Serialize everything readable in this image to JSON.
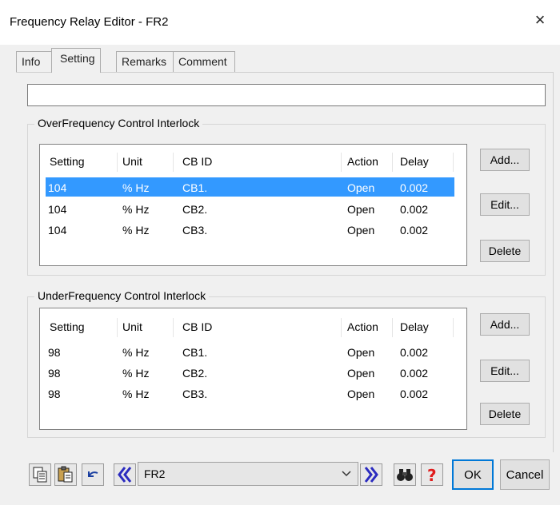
{
  "window": {
    "title": "Frequency Relay Editor - FR2",
    "close_glyph": "×"
  },
  "tabs": [
    {
      "label": "Info",
      "active": false
    },
    {
      "label": "Setting",
      "active": true
    },
    {
      "label": "Remarks",
      "active": false
    },
    {
      "label": "Comment",
      "active": false
    }
  ],
  "top_field": {
    "value": ""
  },
  "over": {
    "title": "OverFrequency Control Interlock",
    "columns": [
      "Setting",
      "Unit",
      "CB ID",
      "Action",
      "Delay"
    ],
    "rows": [
      [
        "104",
        "% Hz",
        "CB1.",
        "Open",
        "0.002"
      ],
      [
        "104",
        "% Hz",
        "CB2.",
        "Open",
        "0.002"
      ],
      [
        "104",
        "% Hz",
        "CB3.",
        "Open",
        "0.002"
      ]
    ],
    "selected_row": 0,
    "buttons": {
      "add": "Add...",
      "edit": "Edit...",
      "delete": "Delete"
    }
  },
  "under": {
    "title": "UnderFrequency Control Interlock",
    "columns": [
      "Setting",
      "Unit",
      "CB ID",
      "Action",
      "Delay"
    ],
    "rows": [
      [
        "98",
        "% Hz",
        "CB1.",
        "Open",
        "0.002"
      ],
      [
        "98",
        "% Hz",
        "CB2.",
        "Open",
        "0.002"
      ],
      [
        "98",
        "% Hz",
        "CB3.",
        "Open",
        "0.002"
      ]
    ],
    "buttons": {
      "add": "Add...",
      "edit": "Edit...",
      "delete": "Delete"
    }
  },
  "footer": {
    "nav_value": "FR2",
    "ok": "OK",
    "cancel": "Cancel"
  },
  "icons": {
    "copy": "copy-icon",
    "paste": "paste-icon",
    "undo": "undo-icon",
    "prev": "previous-icon",
    "next": "next-icon",
    "find": "binoculars-icon",
    "help": "help-icon"
  },
  "colors": {
    "selection": "#3399ff",
    "nav_arrow": "#2b2bbf",
    "help_red": "#e01b1b"
  }
}
